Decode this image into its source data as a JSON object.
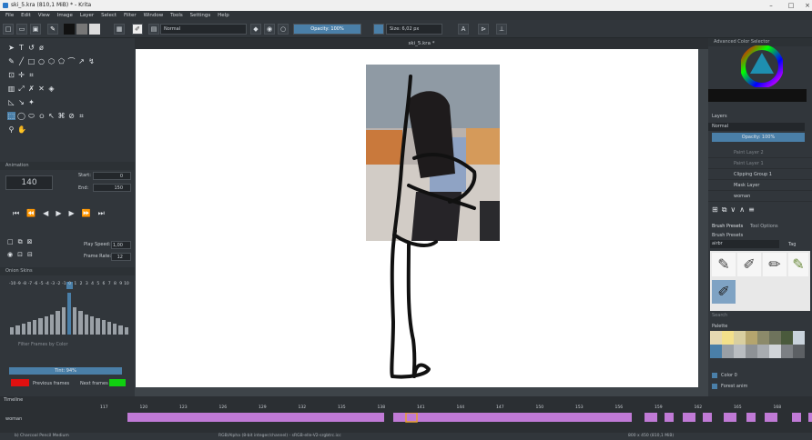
{
  "window": {
    "title": "ski_5.kra (810,1 MiB) * - Krita"
  },
  "menu": [
    "File",
    "Edit",
    "View",
    "Image",
    "Layer",
    "Select",
    "Filter",
    "Window",
    "Tools",
    "Settings",
    "Help"
  ],
  "toolbar": {
    "blend_mode": "Normal",
    "opacity": "Opacity: 100%",
    "size": "Size: 6,02 px"
  },
  "document": {
    "tab_title": "ski_5.kra *"
  },
  "animation": {
    "title": "Animation",
    "current_frame": "140",
    "start_label": "Start:",
    "start_value": "0",
    "end_label": "End:",
    "end_value": "150",
    "play_speed_label": "Play Speed:",
    "play_speed_value": "1,00",
    "frame_rate_label": "Frame Rate:",
    "frame_rate_value": "12"
  },
  "onion": {
    "title": "Onion Skins",
    "numbers": [
      "-10",
      "-9",
      "-8",
      "-7",
      "-6",
      "-5",
      "-4",
      "-3",
      "-2",
      "-1",
      "0",
      "1",
      "2",
      "3",
      "4",
      "5",
      "6",
      "7",
      "8",
      "9",
      "10"
    ],
    "filter_label": "Filter Frames by Color",
    "tint_label": "Tint: 94%",
    "previous_label": "Previous frames",
    "next_label": "Next frames",
    "previous_color": "#e01010",
    "next_color": "#10d010"
  },
  "color_selector": {
    "title": "Advanced Color Selector"
  },
  "layers": {
    "title": "Layers",
    "blend": "Normal",
    "opacity": "Opacity: 100%",
    "rows": [
      "Paint Layer 2",
      "Paint Layer 1",
      "Clipping Group 1",
      "Mask Layer",
      "woman"
    ]
  },
  "brush_presets": {
    "tab1": "Brush Presets",
    "tab2": "Tool Options",
    "title": "Brush Presets",
    "filter": "airbr",
    "tag": "Tag",
    "search": "Search"
  },
  "palette": {
    "title": "Palette",
    "color_label": "Color 0",
    "preset": "Forest anim"
  },
  "timeline": {
    "title": "Timeline",
    "layer_name": "woman",
    "frame_numbers": [
      "117",
      "120",
      "123",
      "126",
      "129",
      "132",
      "135",
      "138",
      "141",
      "144",
      "147",
      "150",
      "153",
      "156",
      "159",
      "162",
      "165",
      "168"
    ],
    "keyframe_color": "#c07ad6"
  },
  "status": {
    "left": "b) Charcoal Pencil Medium",
    "center": "RGB/Alpha (8-bit integer/channel) - sRGB-elle-V2-srgbtrc.icc",
    "right": "800 x 450 (810,1 MiB)"
  }
}
